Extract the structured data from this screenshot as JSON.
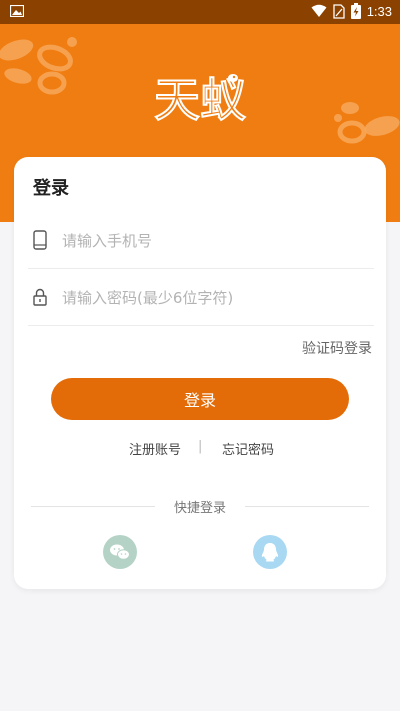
{
  "status_bar": {
    "time": "1:33",
    "icons": [
      "image-icon",
      "wifi-icon",
      "sim-icon",
      "battery-charging-icon"
    ]
  },
  "hero": {
    "logo_text": "天蚁",
    "background_color": "#f07d12"
  },
  "login_card": {
    "title": "登录",
    "phone_field": {
      "placeholder": "请输入手机号",
      "value": "",
      "icon": "phone-icon"
    },
    "password_field": {
      "placeholder": "请输入密码(最少6位字符)",
      "value": "",
      "icon": "lock-icon"
    },
    "sms_login_link": "验证码登录",
    "login_button": "登录",
    "register_link": "注册账号",
    "separator": "|",
    "forgot_link": "忘记密码",
    "quick_login_label": "快捷登录",
    "social_logins": [
      {
        "name": "wechat",
        "icon": "wechat-icon",
        "color": "#b5d2c6"
      },
      {
        "name": "qq",
        "icon": "qq-icon",
        "color": "#a8d8f2"
      }
    ]
  },
  "colors": {
    "accent": "#e46c08",
    "status_bar": "#8b4200"
  }
}
